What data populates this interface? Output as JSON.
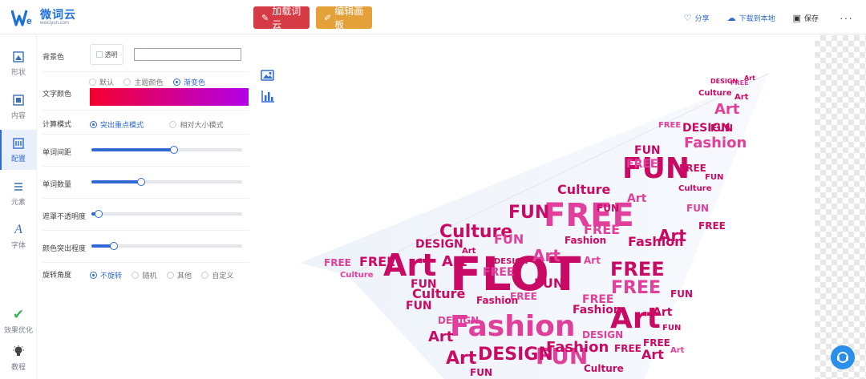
{
  "app": {
    "logo_name": "微词云",
    "logo_sub": "weiciyun.com"
  },
  "toolbar": {
    "load_label": "加载词云",
    "edit_label": "编辑画板",
    "share_label": "分享",
    "download_label": "下载到本地",
    "save_label": "保存",
    "more_label": "···"
  },
  "rail": {
    "items": [
      {
        "label": "形状",
        "icon": "shape-icon"
      },
      {
        "label": "内容",
        "icon": "content-icon"
      },
      {
        "label": "配置",
        "icon": "config-icon"
      },
      {
        "label": "元素",
        "icon": "element-icon"
      },
      {
        "label": "字体",
        "icon": "font-icon"
      }
    ],
    "optimize_label": "效果优化",
    "tutorial_label": "教程"
  },
  "panel": {
    "bg_label": "背景色",
    "transparent_label": "透明",
    "bg_value": "",
    "text_color_label": "文字颜色",
    "color_options": [
      "默认",
      "主题颜色",
      "渐变色"
    ],
    "gradient": {
      "from": "#f5002d",
      "to": "#b100e8"
    },
    "calc_mode_label": "计算模式",
    "calc_options": [
      "突出重点模式",
      "相对大小模式"
    ],
    "spacing_label": "单词间距",
    "spacing_value": 55,
    "count_label": "单词数量",
    "count_value": 33,
    "mask_opacity_label": "遮罩不透明度",
    "mask_opacity_value": 5,
    "color_emphasis_label": "颜色突出程度",
    "color_emphasis_value": 15,
    "rotate_label": "旋转角度",
    "rotate_options": [
      "不旋转",
      "随机",
      "其他",
      "自定义"
    ]
  },
  "cloud": {
    "words": [
      "FLOT",
      "FREE",
      "FUN",
      "Art",
      "Fashion",
      "Culture",
      "DESIGN"
    ]
  },
  "colors": {
    "accent": "#2f6bd0",
    "load_btn": "#d63b45",
    "edit_btn": "#e4a13a",
    "word_dark": "#c80a64",
    "word_light": "#e0409b"
  }
}
